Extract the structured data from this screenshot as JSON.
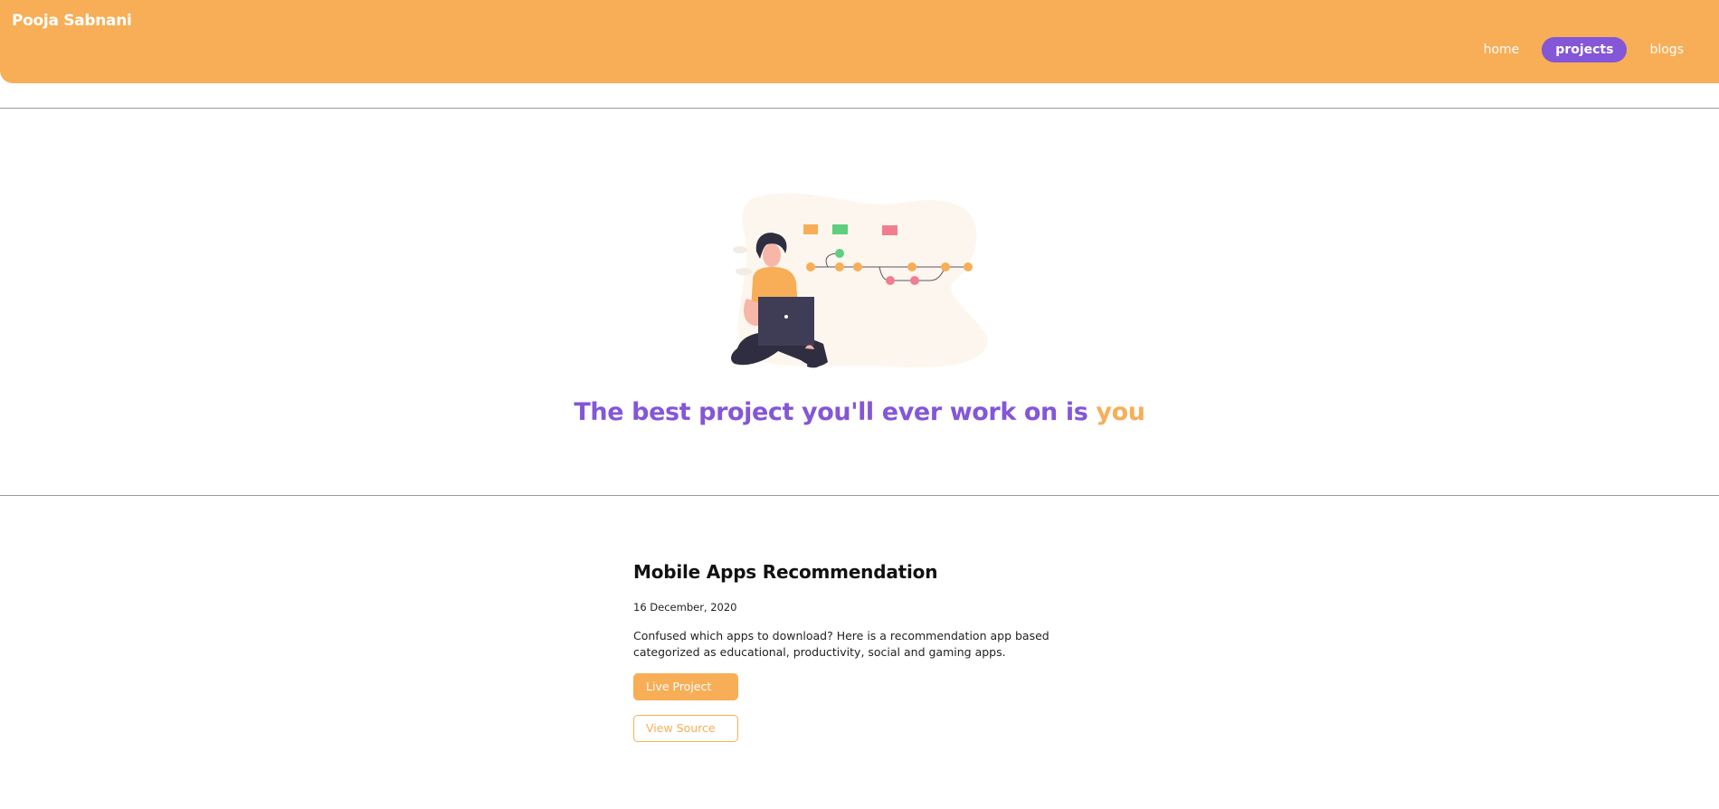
{
  "header": {
    "brand": "Pooja Sabnani",
    "nav": [
      {
        "label": "home",
        "active": false
      },
      {
        "label": "projects",
        "active": true
      },
      {
        "label": "blogs",
        "active": false
      }
    ]
  },
  "hero": {
    "tagline_main": "The best project you'll ever work on is ",
    "tagline_accent": "you",
    "illustration_icon": "person-with-laptop-git-branches-illustration"
  },
  "project": {
    "title": "Mobile Apps Recommendation",
    "date": "16 December, 2020",
    "description": "Confused which apps to download? Here is a recommendation app based categorized as educational, productivity, social and gaming apps.",
    "live_label": "Live Project",
    "source_label": "View Source"
  },
  "colors": {
    "accent_orange": "#f7ae57",
    "accent_purple": "#8456d8"
  }
}
